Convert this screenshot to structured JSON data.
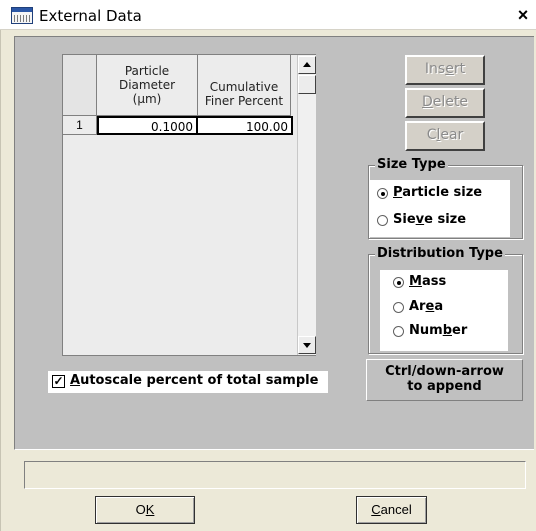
{
  "window": {
    "title": "External Data",
    "icon": "window-icon",
    "close_glyph": "×"
  },
  "table": {
    "columns": [
      "Particle Diameter (µm)",
      "Cumulative Finer Percent"
    ],
    "col1_lines": [
      "Particle",
      "Diameter",
      "(µm)"
    ],
    "col2_lines": [
      "Cumulative",
      "Finer Percent"
    ],
    "rows": [
      {
        "num": "1",
        "diameter": "0.1000",
        "percent": "100.00"
      }
    ]
  },
  "buttons": {
    "insert": {
      "pre": "Ins",
      "key": "e",
      "post": "rt",
      "disabled": true
    },
    "delete": {
      "pre": "",
      "key": "D",
      "post": "elete",
      "disabled": true
    },
    "clear": {
      "pre": "C",
      "key": "l",
      "post": "ear",
      "disabled": true
    },
    "ok": {
      "pre": "O",
      "key": "K",
      "post": ""
    },
    "cancel": {
      "pre": "",
      "key": "C",
      "post": "ancel"
    }
  },
  "autoscale": {
    "checked": true,
    "check_glyph": "✓",
    "key": "A",
    "rest": "utoscale percent of total sample"
  },
  "size_type": {
    "label": "Size Type",
    "options": [
      {
        "pre": "",
        "key": "P",
        "post": "article size",
        "selected": true
      },
      {
        "pre": "Sie",
        "key": "v",
        "post": "e size",
        "selected": false
      }
    ]
  },
  "distribution_type": {
    "label": "Distribution Type",
    "options": [
      {
        "pre": "",
        "key": "M",
        "post": "ass",
        "selected": true
      },
      {
        "pre": "Ar",
        "key": "e",
        "post": "a",
        "selected": false
      },
      {
        "pre": "Num",
        "key": "b",
        "post": "er",
        "selected": false
      }
    ]
  },
  "hint": {
    "line1": "Ctrl/down-arrow",
    "line2": "to append"
  },
  "status_text": ""
}
